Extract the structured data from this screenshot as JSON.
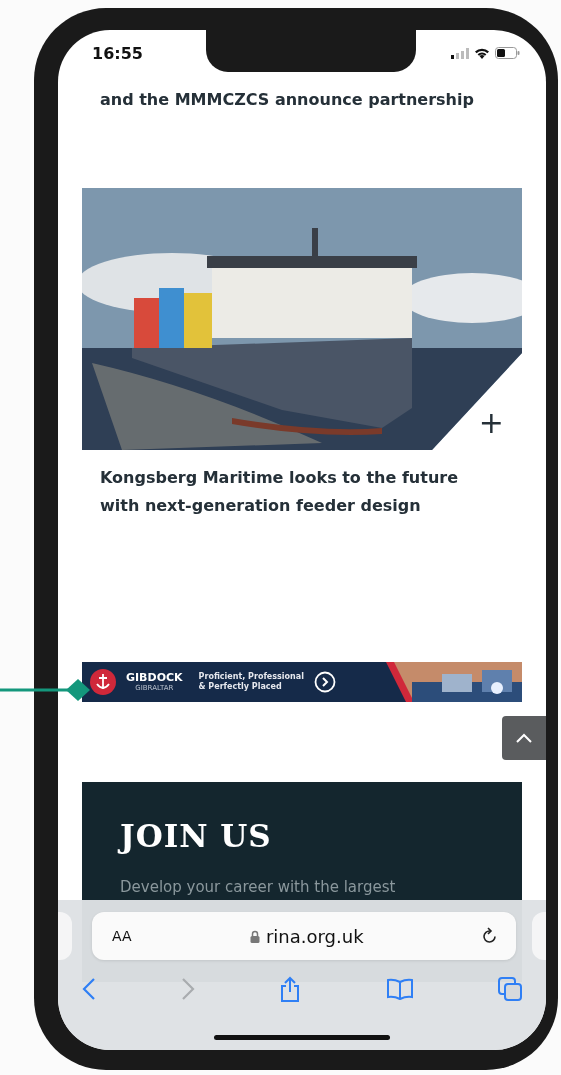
{
  "status_bar": {
    "time": "16:55"
  },
  "partial_headline": "and the MMMCZCS announce partnership",
  "article": {
    "expand_icon": "+",
    "title": "Kongsberg Maritime looks to the future with next-generation feeder design"
  },
  "ad": {
    "brand": "GIBDOCK",
    "location": "GIBRALTAR",
    "tagline_lines": [
      "Proficient, Professional",
      "& Perfectly Placed"
    ]
  },
  "join": {
    "heading": "JOIN US",
    "text": "Develop your career with the largest"
  },
  "browser": {
    "text_size": "AA",
    "url": "rina.org.uk",
    "back_disabled": false,
    "forward_disabled": true
  }
}
